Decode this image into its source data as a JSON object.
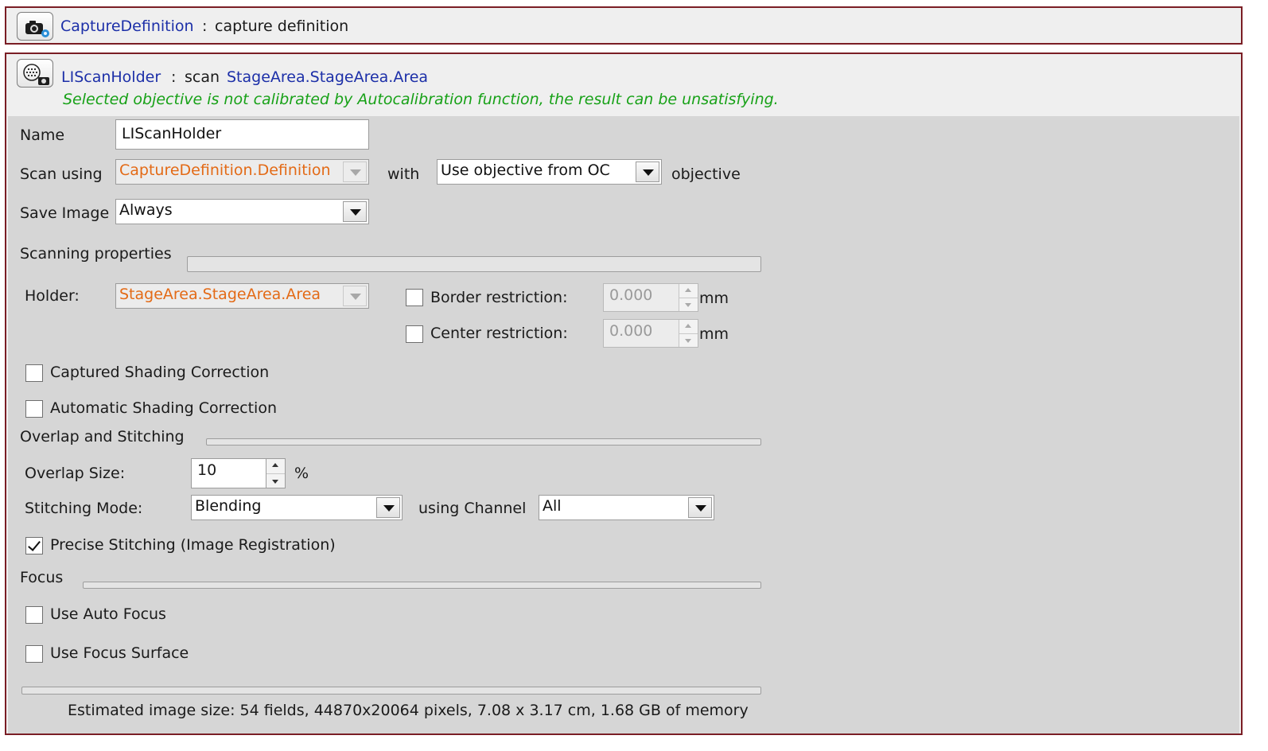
{
  "capture_header": {
    "link": "CaptureDefinition",
    "separator": ":",
    "text": "capture definition",
    "icon": "camera-settings-icon"
  },
  "scan_header": {
    "link": "LIScanHolder",
    "separator": ":",
    "verb": "scan",
    "target_link": "StageArea.StageArea.Area",
    "warning": "Selected objective is not calibrated by Autocalibration function, the result can be unsatisfying.",
    "icon": "scan-camera-icon"
  },
  "colors": {
    "frame_border": "#7a1e25",
    "link": "#1c2fa8",
    "warning": "#17a117",
    "disabled_value": "#e36a16",
    "panel_bg": "#d6d6d6"
  },
  "form": {
    "name_label": "Name",
    "name_value": "LIScanHolder",
    "scan_using_label": "Scan using",
    "scan_using_value": "CaptureDefinition.Definition",
    "with_label": "with",
    "objective_value": "Use objective from OC",
    "objective_label": "objective",
    "save_image_label": "Save Image",
    "save_image_value": "Always"
  },
  "scanning": {
    "section_title": "Scanning properties",
    "holder_label": "Holder:",
    "holder_value": "StageArea.StageArea.Area",
    "border_restriction_label": "Border restriction:",
    "border_restriction_value": "0.000",
    "border_restriction_unit": "mm",
    "border_restriction_checked": false,
    "center_restriction_label": "Center restriction:",
    "center_restriction_value": "0.000",
    "center_restriction_unit": "mm",
    "center_restriction_checked": false,
    "captured_shading_label": "Captured Shading Correction",
    "captured_shading_checked": false,
    "automatic_shading_label": "Automatic Shading Correction",
    "automatic_shading_checked": false
  },
  "stitching": {
    "section_title": "Overlap and Stitching",
    "overlap_label": "Overlap Size:",
    "overlap_value": "10",
    "overlap_unit": "%",
    "mode_label": "Stitching Mode:",
    "mode_value": "Blending",
    "channel_label": "using Channel",
    "channel_value": "All",
    "precise_label": "Precise Stitching (Image Registration)",
    "precise_checked": true
  },
  "focus": {
    "section_title": "Focus",
    "auto_focus_label": "Use Auto Focus",
    "auto_focus_checked": false,
    "focus_surface_label": "Use Focus Surface",
    "focus_surface_checked": false
  },
  "estimate": "Estimated image size: 54 fields, 44870x20064 pixels, 7.08 x 3.17 cm, 1.68 GB of memory"
}
